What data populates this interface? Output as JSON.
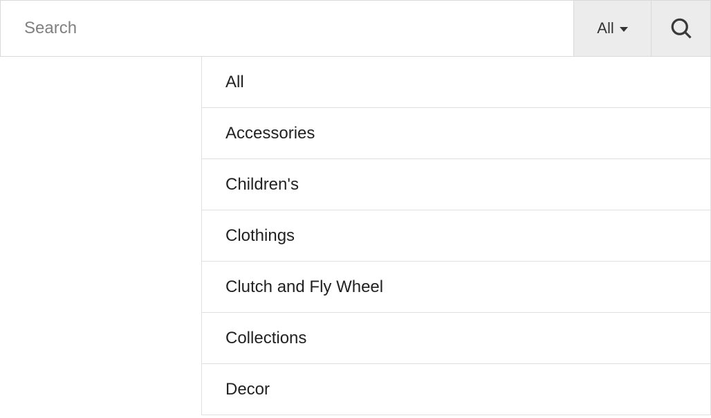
{
  "search": {
    "placeholder": "Search",
    "value": ""
  },
  "category_selector": {
    "selected": "All"
  },
  "dropdown": {
    "items": [
      {
        "label": "All"
      },
      {
        "label": "Accessories"
      },
      {
        "label": "Children's"
      },
      {
        "label": "Clothings"
      },
      {
        "label": "Clutch and Fly Wheel"
      },
      {
        "label": "Collections"
      },
      {
        "label": "Decor"
      }
    ]
  }
}
